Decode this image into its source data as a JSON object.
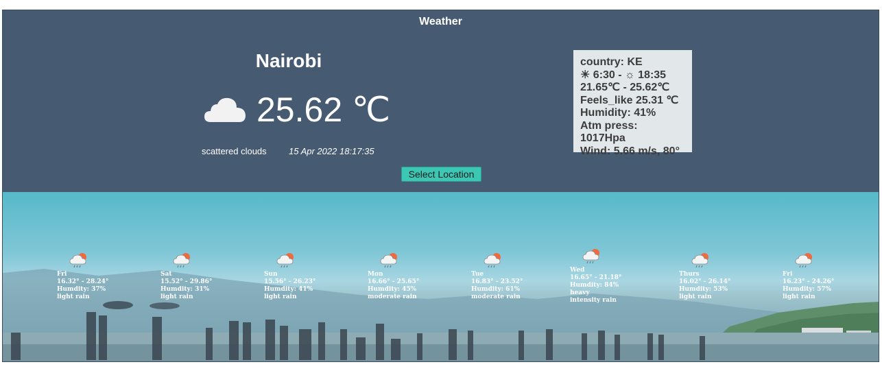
{
  "header": {
    "title": "Weather"
  },
  "current": {
    "city": "Nairobi",
    "icon": "cloud-icon",
    "temperature": "25.62 ℃",
    "description": "scattered clouds",
    "datetime": "15 Apr 2022 18:17:35"
  },
  "actions": {
    "select_location": "Select Location"
  },
  "details": {
    "country": "country: KE",
    "sun": "☀ 6:30 - ☼ 18:35",
    "range": "21.65℃ - 25.62℃",
    "feels_like": "Feels_like 25.31 ℃",
    "humidity": "Humidity: 41%",
    "pressure": "Atm press: 1017Hpa",
    "wind": "Wind: 5.66 m/s, 80°"
  },
  "forecast": [
    {
      "icon": "rain-sun-icon",
      "day": "Fri",
      "range": "16.32° - 28.24°",
      "humidity": "Humdity: 37%",
      "desc": "light rain"
    },
    {
      "icon": "rain-sun-icon",
      "day": "Sat",
      "range": "15.52° - 29.86°",
      "humidity": "Humdity: 31%",
      "desc": "light rain"
    },
    {
      "icon": "rain-sun-icon",
      "day": "Sun",
      "range": "15.56° - 26.23°",
      "humidity": "Humdity: 41%",
      "desc": "light rain"
    },
    {
      "icon": "rain-sun-icon",
      "day": "Mon",
      "range": "16.66° - 25.65°",
      "humidity": "Humdity: 45%",
      "desc": "moderate rain"
    },
    {
      "icon": "rain-sun-icon",
      "day": "Tue",
      "range": "16.83° - 23.52°",
      "humidity": "Humdity: 61%",
      "desc": "moderate rain"
    },
    {
      "icon": "rain-sun-icon",
      "day": "Wed",
      "range": "16.65° - 21.18°",
      "humidity": "Humdity: 84%",
      "desc": "heavy intensity rain"
    },
    {
      "icon": "rain-sun-icon",
      "day": "Thurs",
      "range": "16.02° - 26.14°",
      "humidity": "Humdity: 53%",
      "desc": "light rain"
    },
    {
      "icon": "rain-sun-icon",
      "day": "Fri",
      "range": "16.23° - 24.26°",
      "humidity": "Humdity: 57%",
      "desc": "light rain"
    }
  ]
}
